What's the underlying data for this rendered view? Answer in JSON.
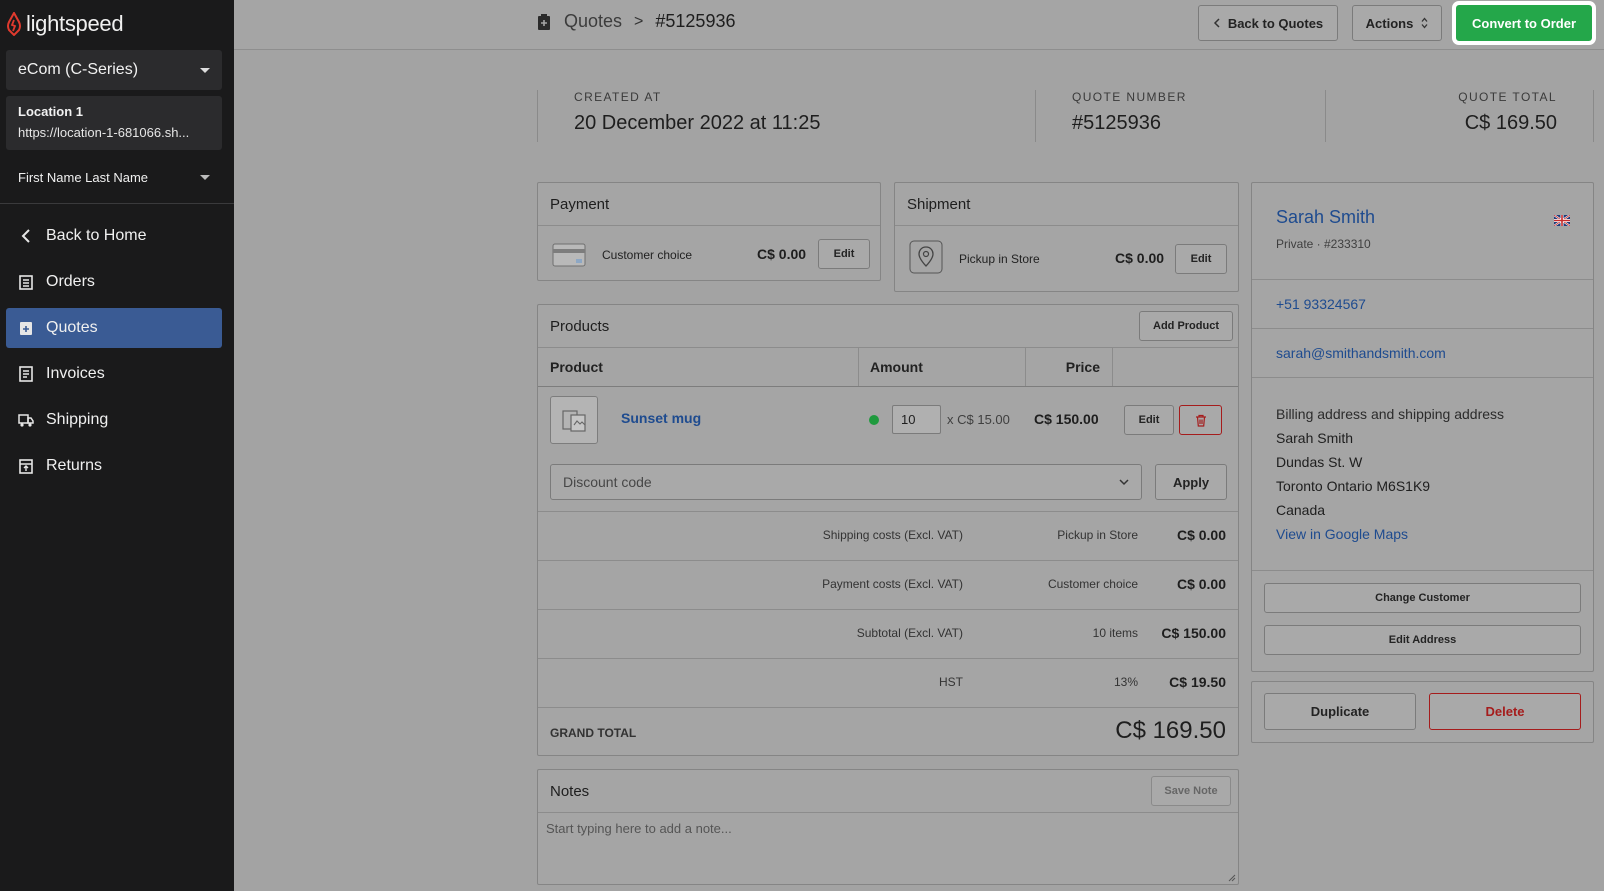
{
  "sidebar": {
    "logo_text": "lightspeed",
    "store_select": "eCom (C-Series)",
    "location": {
      "name": "Location 1",
      "url": "https://location-1-681066.sh..."
    },
    "user": "First Name Last Name",
    "nav": [
      {
        "label": "Back to Home",
        "icon": "chevron-left-icon"
      },
      {
        "label": "Orders",
        "icon": "clipboard-icon"
      },
      {
        "label": "Quotes",
        "icon": "quote-icon",
        "active": true
      },
      {
        "label": "Invoices",
        "icon": "invoice-icon"
      },
      {
        "label": "Shipping",
        "icon": "truck-icon"
      },
      {
        "label": "Returns",
        "icon": "returns-icon"
      }
    ]
  },
  "topbar": {
    "breadcrumb_parent": "Quotes",
    "breadcrumb_separator": ">",
    "breadcrumb_current": "#5125936",
    "back_button": "Back to Quotes",
    "actions_button": "Actions",
    "convert_button": "Convert to Order"
  },
  "stats": {
    "created_label": "CREATED AT",
    "created_value": "20 December 2022 at 11:25",
    "number_label": "QUOTE NUMBER",
    "number_value": "#5125936",
    "total_label": "QUOTE TOTAL",
    "total_value": "C$ 169.50"
  },
  "payment": {
    "title": "Payment",
    "method": "Customer choice",
    "amount": "C$ 0.00",
    "edit": "Edit"
  },
  "shipment": {
    "title": "Shipment",
    "method": "Pickup in Store",
    "amount": "C$ 0.00",
    "edit": "Edit"
  },
  "products": {
    "title": "Products",
    "add_button": "Add Product",
    "columns": {
      "product": "Product",
      "amount": "Amount",
      "price": "Price"
    },
    "items": [
      {
        "name": "Sunset mug",
        "quantity": "10",
        "unit_price": "x C$ 15.00",
        "price": "C$ 150.00",
        "edit": "Edit"
      }
    ],
    "discount_placeholder": "Discount code",
    "apply_button": "Apply",
    "summary": [
      {
        "label": "Shipping costs (Excl. VAT)",
        "detail": "Pickup in Store",
        "value": "C$ 0.00"
      },
      {
        "label": "Payment costs (Excl. VAT)",
        "detail": "Customer choice",
        "value": "C$ 0.00"
      },
      {
        "label": "Subtotal (Excl. VAT)",
        "detail": "10 items",
        "value": "C$ 150.00"
      },
      {
        "label": "HST",
        "detail": "13%",
        "value": "C$ 19.50"
      }
    ],
    "grand_total_label": "GRAND TOTAL",
    "grand_total_value": "C$ 169.50"
  },
  "notes": {
    "title": "Notes",
    "save_button": "Save Note",
    "placeholder": "Start typing here to add a note..."
  },
  "customer": {
    "name": "Sarah Smith",
    "subtitle": "Private · #233310",
    "phone": "+51 93324567",
    "email": "sarah@smithandsmith.com",
    "address_title": "Billing address and shipping address",
    "address_lines": [
      "Sarah Smith",
      "Dundas St. W",
      "Toronto Ontario M6S1K9",
      "Canada"
    ],
    "map_link": "View in Google Maps",
    "change_button": "Change Customer",
    "edit_address_button": "Edit Address",
    "duplicate_button": "Duplicate",
    "delete_button": "Delete"
  },
  "colors": {
    "accent_green": "#24a74a",
    "active_nav": "#3a5b94",
    "danger": "#a51c1c",
    "link": "#1e4b8f",
    "status_dot": "#1f9a3e"
  }
}
